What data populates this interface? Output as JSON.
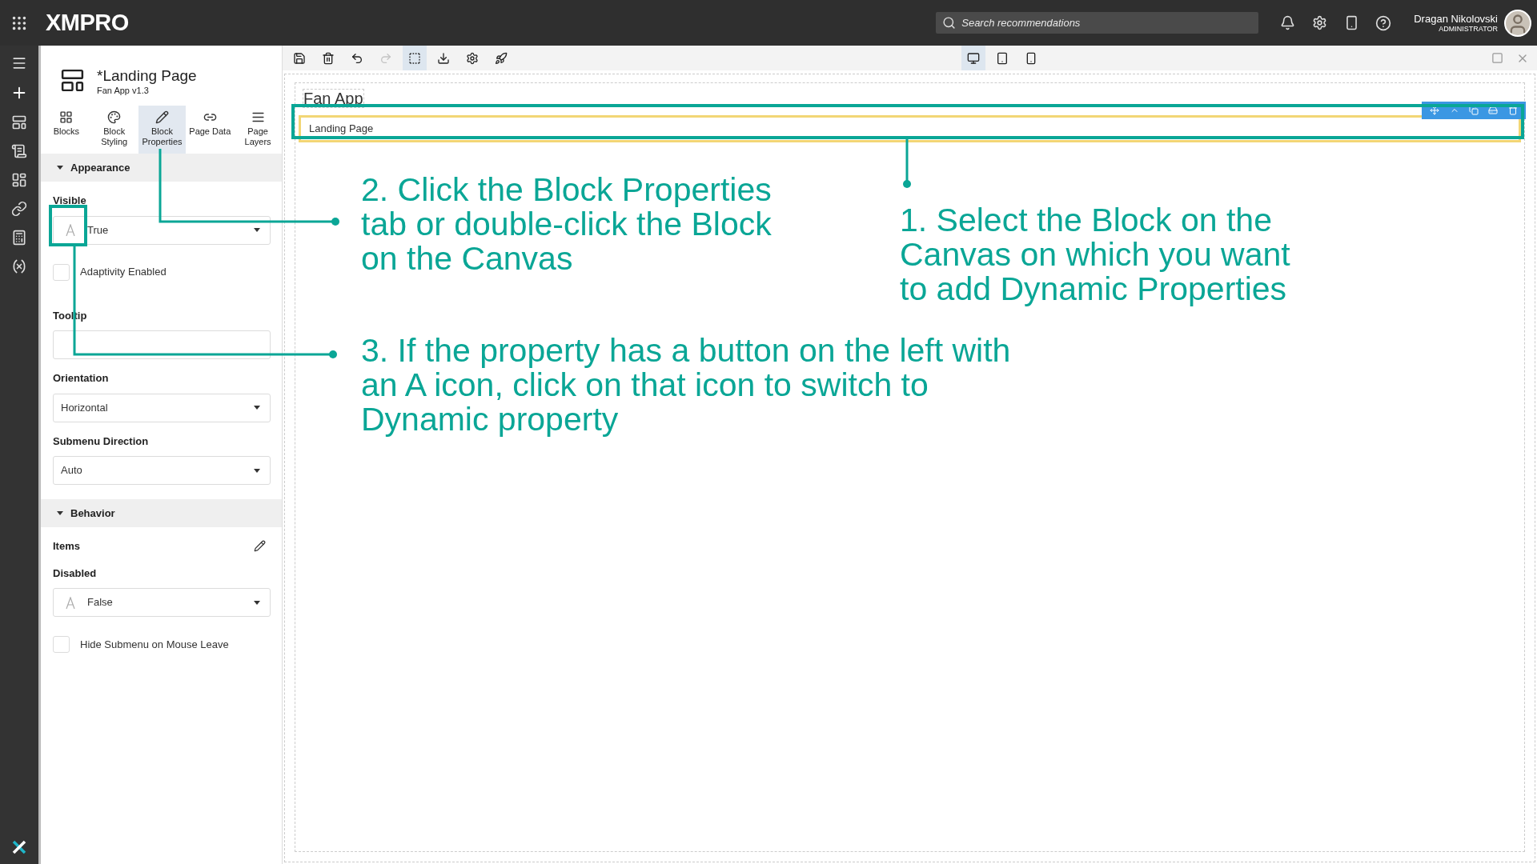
{
  "topbar": {
    "logo": "XMPRO",
    "search": {
      "placeholder": "Search recommendations"
    },
    "user": {
      "name": "Dragan Nikolovski",
      "role": "ADMINISTRATOR"
    }
  },
  "page_header": {
    "title": "*Landing Page",
    "subtitle": "Fan App v1.3"
  },
  "panel_tabs": [
    {
      "kind": "blocks",
      "label": "Blocks",
      "selected": false
    },
    {
      "kind": "styling",
      "label": "Block Styling",
      "selected": false
    },
    {
      "kind": "properties",
      "label": "Block Properties",
      "selected": true
    },
    {
      "kind": "data",
      "label": "Page Data",
      "selected": false
    },
    {
      "kind": "layers",
      "label": "Page Layers",
      "selected": false
    }
  ],
  "sections": [
    {
      "title": "Appearance",
      "expanded": true,
      "properties": [
        {
          "kind": "select",
          "label": "Visible",
          "value": "True",
          "dynamic_toggle": true
        },
        {
          "kind": "checkbox",
          "label": "Adaptivity Enabled",
          "checked": false
        },
        {
          "kind": "text",
          "label": "Tooltip"
        },
        {
          "kind": "select",
          "label": "Orientation",
          "value": "Horizontal"
        },
        {
          "kind": "select",
          "label": "Submenu Direction",
          "value": "Auto"
        }
      ]
    },
    {
      "title": "Behavior",
      "expanded": true,
      "properties": [
        {
          "kind": "editor",
          "label": "Items"
        },
        {
          "kind": "select",
          "label": "Disabled",
          "value": "False",
          "dynamic_toggle": true
        },
        {
          "kind": "checkbox",
          "label": "Hide Submenu on Mouse Leave",
          "checked": false
        }
      ]
    }
  ],
  "tools": [
    {
      "kind": "save",
      "selected": false,
      "disabled": false
    },
    {
      "kind": "delete",
      "selected": false,
      "disabled": false
    },
    {
      "kind": "undo",
      "selected": false,
      "disabled": false
    },
    {
      "kind": "redo",
      "selected": false,
      "disabled": true
    },
    {
      "kind": "select",
      "selected": true,
      "disabled": false
    },
    {
      "kind": "download",
      "selected": false,
      "disabled": false
    },
    {
      "kind": "settings",
      "selected": false,
      "disabled": false
    },
    {
      "kind": "publish",
      "selected": false,
      "disabled": false
    }
  ],
  "devices": [
    {
      "kind": "desktop",
      "selected": true
    },
    {
      "kind": "tablet",
      "selected": false
    },
    {
      "kind": "phone",
      "selected": false
    }
  ],
  "canvas": {
    "title": "Fan App",
    "blocks": [
      {
        "label": "Landing Page",
        "selected": true
      }
    ]
  },
  "annotations": [
    {
      "kind": "tab",
      "text": "2. Click the Block Properties tab or double-click the Block on the Canvas"
    },
    {
      "kind": "block",
      "text": "1. Select the Block on the Canvas on which you want to add Dynamic Properties"
    },
    {
      "kind": "toggle",
      "text": "3. If the property has a button on the left with an A icon, click on that icon to switch to Dynamic property"
    }
  ]
}
